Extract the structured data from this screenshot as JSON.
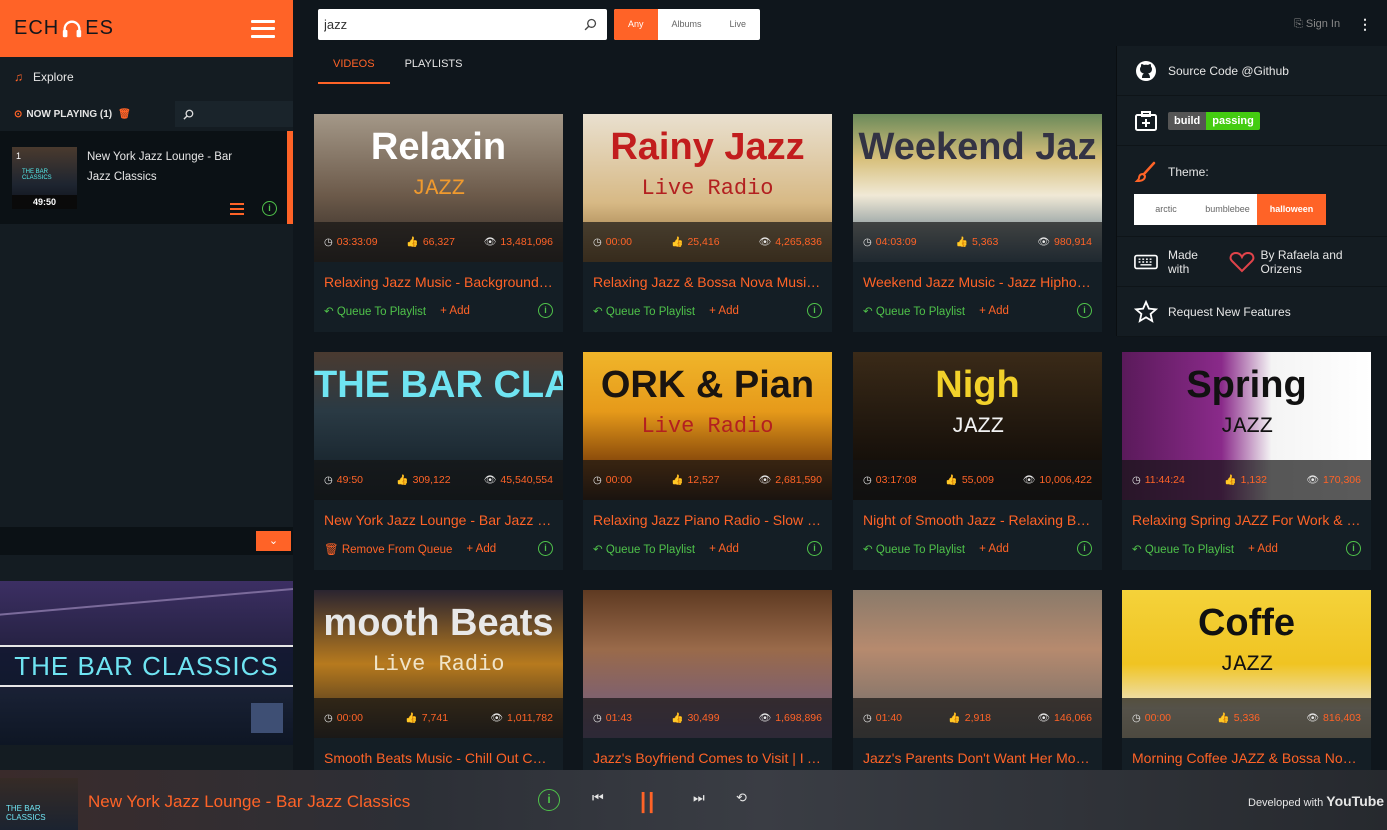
{
  "app": {
    "logo_text_left": "ECH",
    "logo_text_right": "ES",
    "explore_label": "Explore",
    "now_playing_label": "NOW PLAYING (1)"
  },
  "queue": {
    "items": [
      {
        "index": "1",
        "title": "New York Jazz Lounge - Bar Jazz Classics",
        "duration": "49:50",
        "thumb_text": "THE BAR CLASSICS"
      }
    ]
  },
  "player": {
    "video_text": "THE BAR CLASSICS",
    "bottom_title": "New York Jazz Lounge - Bar Jazz Classics",
    "thumb_text": "THE BAR CLASSICS",
    "developed_with": "Developed with",
    "youtube": "YouTube"
  },
  "search": {
    "value": "jazz",
    "filters": [
      "Any",
      "Albums",
      "Live"
    ],
    "active_filter": "Any"
  },
  "header": {
    "sign_in": "Sign In"
  },
  "tabs": [
    {
      "label": "VIDEOS",
      "active": true
    },
    {
      "label": "PLAYLISTS",
      "active": false
    }
  ],
  "dropdown": {
    "source_code": "Source Code @Github",
    "build_left": "build",
    "build_right": "passing",
    "theme_label": "Theme:",
    "themes": [
      "arctic",
      "bumblebee",
      "halloween"
    ],
    "active_theme": "halloween",
    "made_with": "Made with",
    "made_by": "By Rafaela and Orizens",
    "request": "Request New Features"
  },
  "videos": [
    {
      "title": "Relaxing Jazz Music - Background Chil...",
      "duration": "03:33:09",
      "likes": "66,327",
      "views": "13,481,096",
      "action": "Queue To Playlist",
      "thumb_line1": "Relaxin",
      "thumb_line2": "JAZZ"
    },
    {
      "title": "Relaxing Jazz & Bossa Nova Music Rad...",
      "duration": "00:00",
      "likes": "25,416",
      "views": "4,265,836",
      "action": "Queue To Playlist",
      "thumb_line1": "Rainy Jazz",
      "thumb_line2": "Live Radio"
    },
    {
      "title": "Weekend Jazz Music - Jazz Hiphop, Jaz...",
      "duration": "04:03:09",
      "likes": "5,363",
      "views": "980,914",
      "action": "Queue To Playlist",
      "thumb_line1": "Weekend Jaz",
      "thumb_line2": ""
    },
    {
      "title": "New York Jazz Lounge - Bar Jazz Classics",
      "duration": "49:50",
      "likes": "309,122",
      "views": "45,540,554",
      "action": "Remove From Queue",
      "thumb_line1": "THE BAR CLASSICS",
      "thumb_line2": ""
    },
    {
      "title": "Relaxing Jazz Piano Radio - Slow Jazz ...",
      "duration": "00:00",
      "likes": "12,527",
      "views": "2,681,590",
      "action": "Queue To Playlist",
      "thumb_line1": "ORK & Pian",
      "thumb_line2": "Live Radio"
    },
    {
      "title": "Night of Smooth Jazz - Relaxing Backg...",
      "duration": "03:17:08",
      "likes": "55,009",
      "views": "10,006,422",
      "action": "Queue To Playlist",
      "thumb_line1": "Nigh",
      "thumb_line2": "JAZZ"
    },
    {
      "title": "Relaxing Spring JAZZ For Work & Study...",
      "duration": "11:44:24",
      "likes": "1,132",
      "views": "170,306",
      "action": "Queue To Playlist",
      "thumb_line1": "Spring",
      "thumb_line2": "JAZZ"
    },
    {
      "title": "Smooth Beats Music - Chill Out Cafe ...",
      "duration": "00:00",
      "likes": "7,741",
      "views": "1,011,782",
      "action": "Queue To Playlist",
      "thumb_line1": "mooth Beats",
      "thumb_line2": "Live Radio"
    },
    {
      "title": "Jazz's Boyfriend Comes to Visit | I Am ...",
      "duration": "01:43",
      "likes": "30,499",
      "views": "1,698,896",
      "action": "Queue To Playlist",
      "thumb_line1": "",
      "thumb_line2": ""
    },
    {
      "title": "Jazz's Parents Don't Want Her Moving...",
      "duration": "01:40",
      "likes": "2,918",
      "views": "146,066",
      "action": "Queue To Playlist",
      "thumb_line1": "",
      "thumb_line2": ""
    },
    {
      "title": "Morning Coffee JAZZ & Bossa Nova M...",
      "duration": "00:00",
      "likes": "5,336",
      "views": "816,403",
      "action": "Queue To Playlist",
      "thumb_line1": "Coffe",
      "thumb_line2": "JAZZ"
    }
  ],
  "card_add_label": "Add",
  "colors": {
    "accent": "#ff6327",
    "success": "#4fc24a",
    "background": "#0f161c",
    "panel": "#141c22"
  }
}
